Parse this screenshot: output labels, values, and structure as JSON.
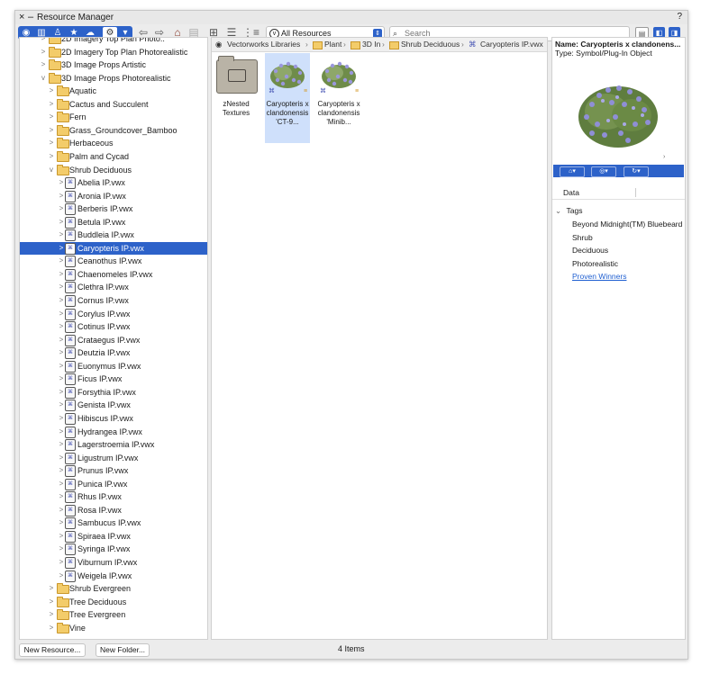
{
  "window": {
    "title": "Resource Manager",
    "close_glyph": "×",
    "minimize_glyph": "–",
    "help_glyph": "?"
  },
  "toolbar": {
    "filter_options": [
      "All Resources"
    ],
    "filter_selected": "All Resources",
    "search_placeholder": "Search"
  },
  "tree": {
    "rows": [
      {
        "label": "2D Imagery Top Plan Photo..",
        "level": 1,
        "kind": "folder",
        "expand": ">"
      },
      {
        "label": "2D Imagery Top Plan Photorealistic",
        "level": 1,
        "kind": "folder",
        "expand": ">"
      },
      {
        "label": "3D Image Props Artistic",
        "level": 1,
        "kind": "folder",
        "expand": ">"
      },
      {
        "label": "3D Image Props Photorealistic",
        "level": 1,
        "kind": "folder",
        "expand": "v"
      },
      {
        "label": "Aquatic",
        "level": 2,
        "kind": "folder",
        "expand": ">"
      },
      {
        "label": "Cactus and Succulent",
        "level": 2,
        "kind": "folder",
        "expand": ">"
      },
      {
        "label": "Fern",
        "level": 2,
        "kind": "folder",
        "expand": ">"
      },
      {
        "label": "Grass_Groundcover_Bamboo",
        "level": 2,
        "kind": "folder",
        "expand": ">"
      },
      {
        "label": "Herbaceous",
        "level": 2,
        "kind": "folder",
        "expand": ">"
      },
      {
        "label": "Palm and Cycad",
        "level": 2,
        "kind": "folder",
        "expand": ">"
      },
      {
        "label": "Shrub Deciduous",
        "level": 2,
        "kind": "folder",
        "expand": "v"
      },
      {
        "label": "Abelia IP.vwx",
        "level": 3,
        "kind": "file",
        "expand": ">"
      },
      {
        "label": "Aronia IP.vwx",
        "level": 3,
        "kind": "file",
        "expand": ">"
      },
      {
        "label": "Berberis IP.vwx",
        "level": 3,
        "kind": "file",
        "expand": ">"
      },
      {
        "label": "Betula IP.vwx",
        "level": 3,
        "kind": "file",
        "expand": ">"
      },
      {
        "label": "Buddleia IP.vwx",
        "level": 3,
        "kind": "file",
        "expand": ">"
      },
      {
        "label": "Caryopteris IP.vwx",
        "level": 3,
        "kind": "file",
        "expand": ">",
        "selected": true
      },
      {
        "label": "Ceanothus IP.vwx",
        "level": 3,
        "kind": "file",
        "expand": ">"
      },
      {
        "label": "Chaenomeles IP.vwx",
        "level": 3,
        "kind": "file",
        "expand": ">"
      },
      {
        "label": "Clethra IP.vwx",
        "level": 3,
        "kind": "file",
        "expand": ">"
      },
      {
        "label": "Cornus IP.vwx",
        "level": 3,
        "kind": "file",
        "expand": ">"
      },
      {
        "label": "Corylus IP.vwx",
        "level": 3,
        "kind": "file",
        "expand": ">"
      },
      {
        "label": "Cotinus IP.vwx",
        "level": 3,
        "kind": "file",
        "expand": ">"
      },
      {
        "label": "Crataegus IP.vwx",
        "level": 3,
        "kind": "file",
        "expand": ">"
      },
      {
        "label": "Deutzia IP.vwx",
        "level": 3,
        "kind": "file",
        "expand": ">"
      },
      {
        "label": "Euonymus IP.vwx",
        "level": 3,
        "kind": "file",
        "expand": ">"
      },
      {
        "label": "Ficus IP.vwx",
        "level": 3,
        "kind": "file",
        "expand": ">"
      },
      {
        "label": "Forsythia IP.vwx",
        "level": 3,
        "kind": "file",
        "expand": ">"
      },
      {
        "label": "Genista IP.vwx",
        "level": 3,
        "kind": "file",
        "expand": ">"
      },
      {
        "label": "Hibiscus IP.vwx",
        "level": 3,
        "kind": "file",
        "expand": ">"
      },
      {
        "label": "Hydrangea IP.vwx",
        "level": 3,
        "kind": "file",
        "expand": ">"
      },
      {
        "label": "Lagerstroemia IP.vwx",
        "level": 3,
        "kind": "file",
        "expand": ">"
      },
      {
        "label": "Ligustrum IP.vwx",
        "level": 3,
        "kind": "file",
        "expand": ">"
      },
      {
        "label": "Prunus IP.vwx",
        "level": 3,
        "kind": "file",
        "expand": ">"
      },
      {
        "label": "Punica IP.vwx",
        "level": 3,
        "kind": "file",
        "expand": ">"
      },
      {
        "label": "Rhus IP.vwx",
        "level": 3,
        "kind": "file",
        "expand": ">"
      },
      {
        "label": "Rosa IP.vwx",
        "level": 3,
        "kind": "file",
        "expand": ">"
      },
      {
        "label": "Sambucus IP.vwx",
        "level": 3,
        "kind": "file",
        "expand": ">"
      },
      {
        "label": "Spiraea IP.vwx",
        "level": 3,
        "kind": "file",
        "expand": ">"
      },
      {
        "label": "Syringa IP.vwx",
        "level": 3,
        "kind": "file",
        "expand": ">"
      },
      {
        "label": "Viburnum IP.vwx",
        "level": 3,
        "kind": "file",
        "expand": ">"
      },
      {
        "label": "Weigela IP.vwx",
        "level": 3,
        "kind": "file",
        "expand": ">"
      },
      {
        "label": "Shrub Evergreen",
        "level": 2,
        "kind": "folder",
        "expand": ">"
      },
      {
        "label": "Tree Deciduous",
        "level": 2,
        "kind": "folder",
        "expand": ">"
      },
      {
        "label": "Tree Evergreen",
        "level": 2,
        "kind": "folder",
        "expand": ">"
      },
      {
        "label": "Vine",
        "level": 2,
        "kind": "folder",
        "expand": ">"
      }
    ]
  },
  "breadcrumbs": [
    {
      "label": "Vectorworks Libraries",
      "kind": "root"
    },
    {
      "label": "Plant",
      "kind": "folder"
    },
    {
      "label": "3D In",
      "kind": "folder"
    },
    {
      "label": "Shrub Deciduous",
      "kind": "folder"
    },
    {
      "label": "Caryopteris IP.vwx",
      "kind": "file"
    }
  ],
  "resources": [
    {
      "caption": "zNested Textures",
      "kind": "folder",
      "selected": false
    },
    {
      "caption": "Caryopteris x clandonensis 'CT-9...",
      "kind": "plant",
      "selected": true
    },
    {
      "caption": "Caryopteris x clandonensis 'Minib...",
      "kind": "plant",
      "selected": false
    }
  ],
  "preview": {
    "name": "Name: Caryopteris x clandonens...",
    "type": "Type: Symbol/Plug-In Object",
    "tab_data": "Data",
    "tags_header": "Tags",
    "tags": [
      "Beyond Midnight(TM) Bluebeard",
      "Shrub",
      "Deciduous",
      "Photorealistic"
    ],
    "link_tag": "Proven Winners"
  },
  "status": {
    "new_resource": "New Resource...",
    "new_folder": "New Folder...",
    "item_count": "4 Items"
  },
  "colors": {
    "accent": "#2d62c9",
    "selection_tile": "#cfe0fb",
    "folder": "#f3cc6a",
    "link": "#1f5fd1"
  }
}
